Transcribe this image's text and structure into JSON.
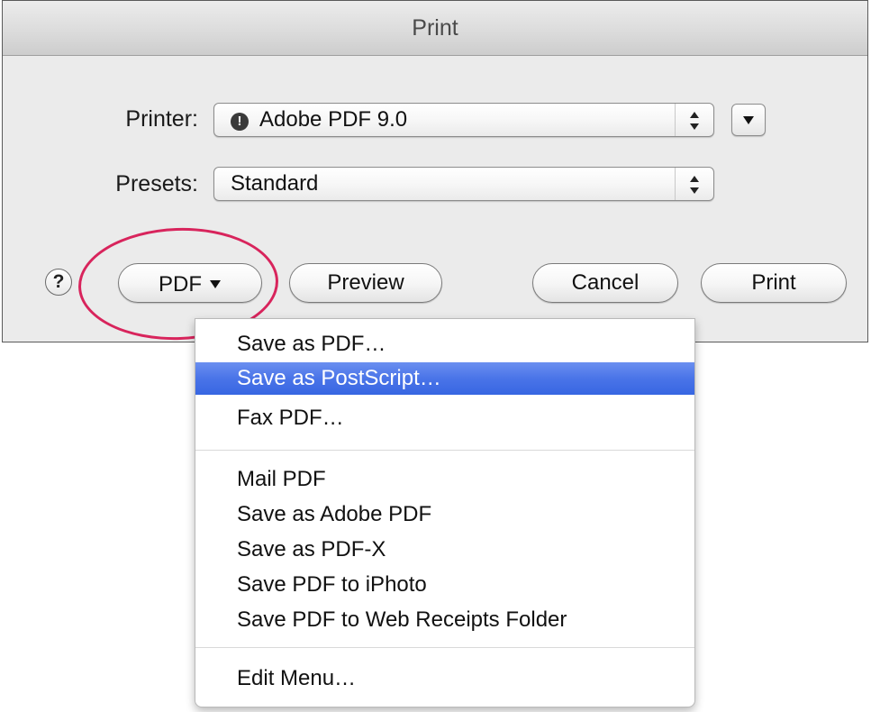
{
  "window": {
    "title": "Print"
  },
  "printer": {
    "label": "Printer:",
    "value": "Adobe PDF 9.0",
    "status_icon": "caution-icon"
  },
  "presets": {
    "label": "Presets:",
    "value": "Standard"
  },
  "buttons": {
    "help": "?",
    "pdf": "PDF",
    "preview": "Preview",
    "cancel": "Cancel",
    "print": "Print"
  },
  "pdf_menu": {
    "items": [
      "Save as PDF…",
      "Save as PostScript…",
      "Fax PDF…",
      "Mail PDF",
      "Save as Adobe PDF",
      "Save as PDF-X",
      "Save PDF to iPhoto",
      "Save PDF to Web Receipts Folder",
      "Edit Menu…"
    ],
    "selected_item": "Save as PostScript…"
  },
  "colors": {
    "highlight_ring": "#d8245c",
    "menu_selection": "#3f6ce6"
  }
}
